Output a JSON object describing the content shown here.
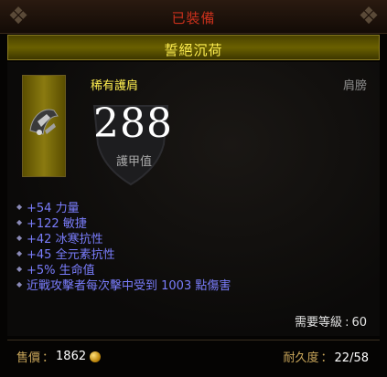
{
  "header": {
    "equipped_label": "已裝備"
  },
  "item": {
    "name": "誓絕沉荷",
    "type": "稀有護肩",
    "slot": "肩膀",
    "armor": "288",
    "armor_label": "護甲值",
    "affixes": [
      "+54 力量",
      "+122 敏捷",
      "+42 冰寒抗性",
      "+45 全元素抗性",
      "+5% 生命值",
      "近戰攻擊者每次擊中受到 1003 點傷害"
    ],
    "required_level_label": "需要等級",
    "required_level": "60"
  },
  "footer": {
    "price_label": "售價",
    "price_value": "1862",
    "durability_label": "耐久度",
    "durability_value": "22/58"
  },
  "colors": {
    "rare_yellow": "#ffef50",
    "affix_blue": "#7a7dfc",
    "equipped_red": "#c8301c"
  },
  "icons": {
    "corner": "skull-corner-icon",
    "item": "shoulder-armor-icon",
    "currency": "gold-coin-icon",
    "affix_bullet": "diamond-bullet-icon"
  }
}
